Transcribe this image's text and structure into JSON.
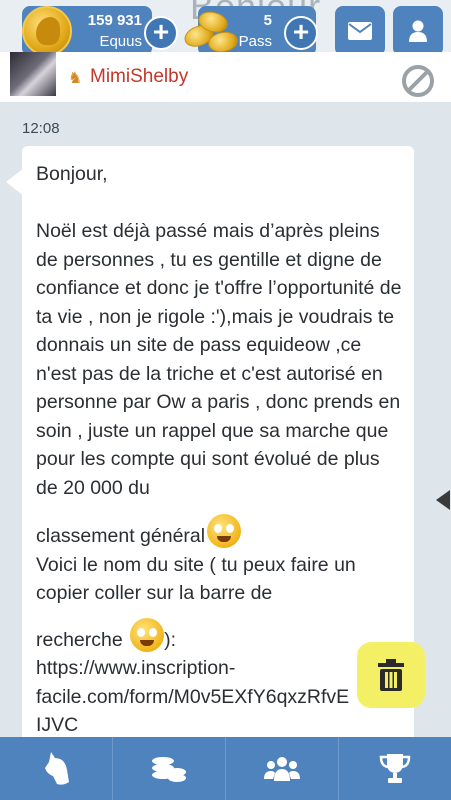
{
  "header": {
    "ghost_title": "Bonjour",
    "equus": {
      "value": "159 931",
      "label": "Equus"
    },
    "pass": {
      "value": "5",
      "label": "Pass"
    },
    "icons": [
      "equus-coin-icon",
      "plus-icon",
      "pass-coins-icon",
      "plus-icon",
      "mail-icon",
      "profile-icon"
    ]
  },
  "sender": {
    "name": "MimiShelby",
    "icons": [
      "avatar",
      "horse-icon",
      "block-icon"
    ]
  },
  "message": {
    "time": "12:08",
    "greeting": "Bonjour,",
    "paragraph": "Noël est déjà passé mais d’après pleins de personnes , tu es gentille et digne de confiance et donc je t'offre l’opportunité de ta vie , non je rigole :'),mais je voudrais te donnais un site de pass equideow ,ce n'est pas de la triche et c'est autorisé en personne par Ow a paris , donc prends en soin , juste un rappel que sa marche que pour les compte qui sont évolué de plus de 20 000 du",
    "line_classement": "classement général",
    "line_voici": "Voici le nom du site ( tu peux faire un copier coller sur la barre de",
    "line_recherche": "recherche",
    "line_recherche_end": "):",
    "url_line1": "https://www.inscription-",
    "url_line2": "facile.com/form/M0v5EXfY6qxzRfvE",
    "url_line3": "IJVC"
  },
  "colors": {
    "accent": "#4f83bd",
    "sender_name": "#c0392b",
    "trash_button": "#f4f066",
    "background": "#dfe6eb"
  },
  "bottom_nav": {
    "items": [
      "horse-head-icon",
      "coins-icon",
      "community-icon",
      "trophy-icon"
    ]
  }
}
